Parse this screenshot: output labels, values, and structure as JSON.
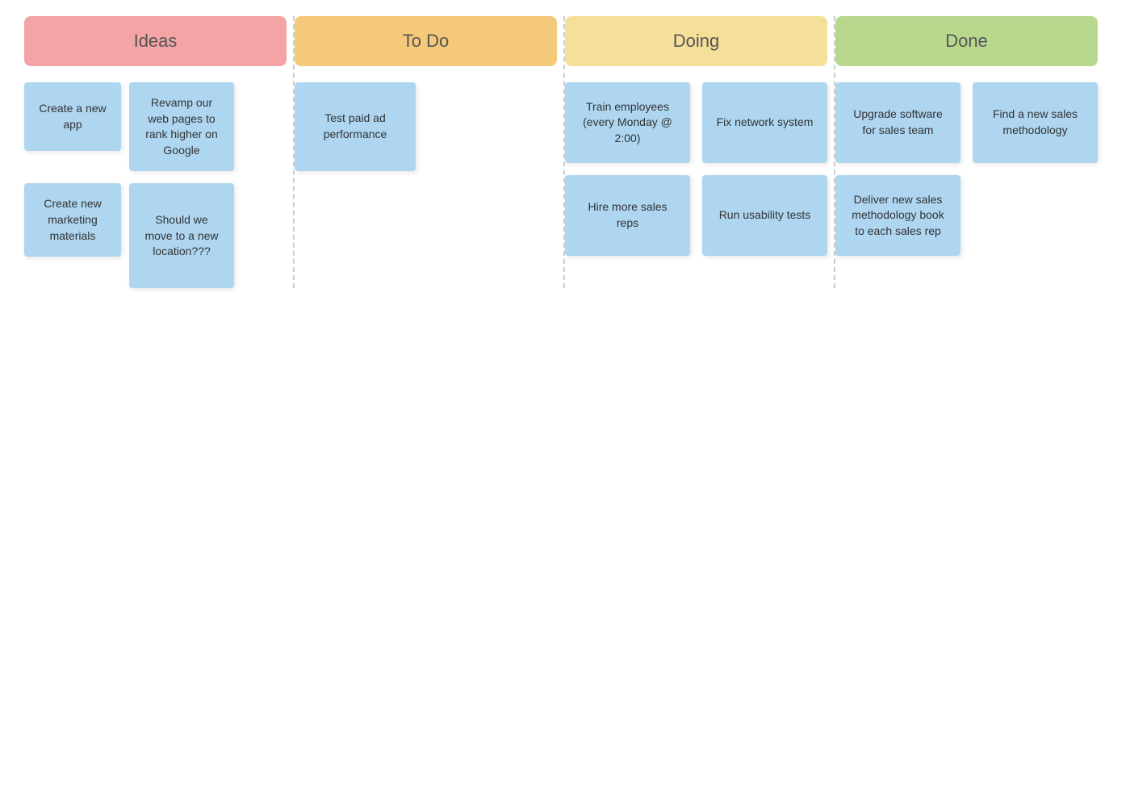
{
  "columns": [
    {
      "id": "ideas",
      "label": "Ideas",
      "headerClass": "ideas",
      "cards": [
        [
          {
            "id": "create-app",
            "text": "Create a new app",
            "size": "sm"
          },
          {
            "id": "revamp-web",
            "text": "Revamp our web pages to rank higher on Google",
            "size": "md"
          }
        ],
        [
          {
            "id": "create-marketing",
            "text": "Create new marketing materials",
            "size": "sm"
          },
          {
            "id": "move-location",
            "text": "Should we move to a new location???",
            "size": "lg"
          }
        ]
      ]
    },
    {
      "id": "todo",
      "label": "To Do",
      "headerClass": "todo",
      "cards": [
        [
          {
            "id": "test-paid-ad",
            "text": "Test paid ad performance",
            "size": "md"
          }
        ]
      ]
    },
    {
      "id": "doing",
      "label": "Doing",
      "headerClass": "doing",
      "cards": [
        {
          "id": "train-employees",
          "text": "Train employees (every Monday @ 2:00)"
        },
        {
          "id": "fix-network",
          "text": "Fix network system"
        },
        {
          "id": "hire-sales",
          "text": "Hire more sales reps"
        },
        {
          "id": "run-usability",
          "text": "Run usability tests"
        }
      ]
    },
    {
      "id": "done",
      "label": "Done",
      "headerClass": "done",
      "cards": [
        {
          "id": "upgrade-software",
          "text": "Upgrade software for sales team"
        },
        {
          "id": "find-methodology",
          "text": "Find a new sales methodology"
        },
        {
          "id": "deliver-book",
          "text": "Deliver new sales methodology book to each sales rep"
        },
        {
          "id": "placeholder-done",
          "text": ""
        }
      ]
    }
  ]
}
